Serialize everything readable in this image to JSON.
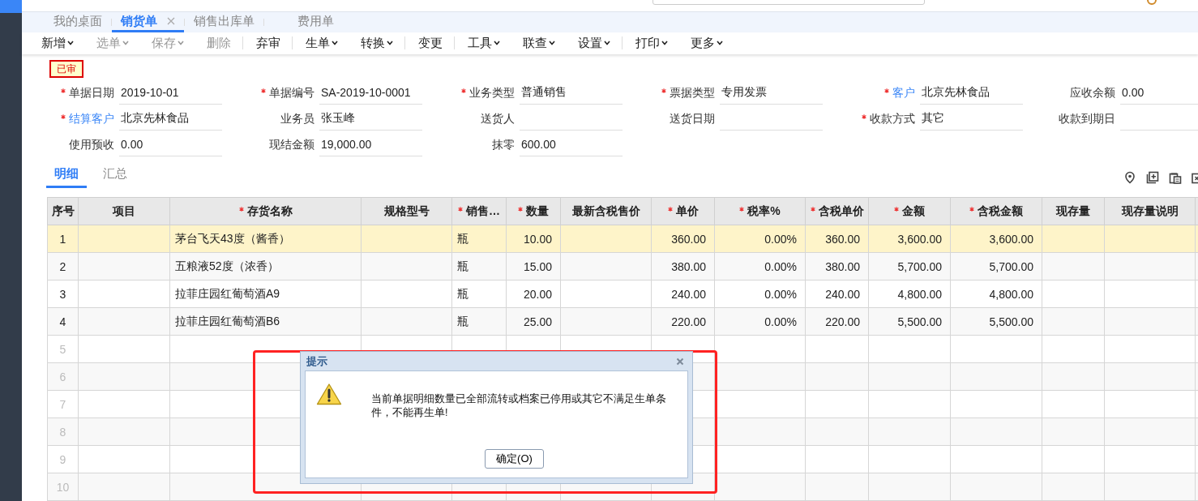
{
  "tabs": [
    {
      "label": "我的桌面",
      "selected": false,
      "closable": false
    },
    {
      "label": "销货单",
      "selected": true,
      "closable": true
    },
    {
      "label": "销售出库单",
      "selected": false,
      "closable": false
    },
    {
      "label": "费用单",
      "selected": false,
      "closable": false
    }
  ],
  "toolbar": [
    {
      "kind": "button",
      "label": "新增",
      "disabled": false,
      "dropdown": true
    },
    {
      "kind": "button",
      "label": "选单",
      "disabled": true,
      "dropdown": true
    },
    {
      "kind": "button",
      "label": "保存",
      "disabled": true,
      "dropdown": true
    },
    {
      "kind": "button",
      "label": "删除",
      "disabled": true,
      "dropdown": false
    },
    {
      "kind": "separator"
    },
    {
      "kind": "button",
      "label": "弃审",
      "disabled": false,
      "dropdown": false
    },
    {
      "kind": "separator"
    },
    {
      "kind": "button",
      "label": "生单",
      "disabled": false,
      "dropdown": true
    },
    {
      "kind": "button",
      "label": "转换",
      "disabled": false,
      "dropdown": true
    },
    {
      "kind": "separator"
    },
    {
      "kind": "button",
      "label": "变更",
      "disabled": false,
      "dropdown": false
    },
    {
      "kind": "separator"
    },
    {
      "kind": "button",
      "label": "工具",
      "disabled": false,
      "dropdown": true
    },
    {
      "kind": "button",
      "label": "联查",
      "disabled": false,
      "dropdown": true
    },
    {
      "kind": "button",
      "label": "设置",
      "disabled": false,
      "dropdown": true
    },
    {
      "kind": "separator"
    },
    {
      "kind": "button",
      "label": "打印",
      "disabled": false,
      "dropdown": true
    },
    {
      "kind": "button",
      "label": "更多",
      "disabled": false,
      "dropdown": true
    }
  ],
  "status_badge": "已审",
  "form_rows": [
    [
      {
        "label": "单据日期",
        "value": "2019-10-01",
        "required": true,
        "link": false
      },
      {
        "label": "单据编号",
        "value": "SA-2019-10-0001",
        "required": true,
        "link": false
      },
      {
        "label": "业务类型",
        "value": "普通销售",
        "required": true,
        "link": false
      },
      {
        "label": "票据类型",
        "value": "专用发票",
        "required": true,
        "link": false
      },
      {
        "label": "客户",
        "value": "北京先林食品",
        "required": true,
        "link": true
      },
      {
        "label": "应收余额",
        "value": "0.00",
        "required": false,
        "link": false
      }
    ],
    [
      {
        "label": "结算客户",
        "value": "北京先林食品",
        "required": true,
        "link": true
      },
      {
        "label": "业务员",
        "value": "张玉峰",
        "required": false,
        "link": false
      },
      {
        "label": "送货人",
        "required": false,
        "link": false
      },
      {
        "label": "送货日期",
        "required": false,
        "link": false
      },
      {
        "label": "收款方式",
        "value": "其它",
        "required": true,
        "link": false
      },
      {
        "label": "收款到期日",
        "required": false,
        "link": false
      }
    ],
    [
      {
        "label": "使用预收",
        "value": "0.00",
        "required": false,
        "link": false
      },
      {
        "label": "现结金额",
        "value": "19,000.00",
        "required": false,
        "link": false
      },
      {
        "label": "抹零",
        "value": "600.00",
        "required": false,
        "link": false
      }
    ]
  ],
  "detail_tabs": [
    {
      "label": "明细",
      "selected": true
    },
    {
      "label": "汇总",
      "selected": false
    }
  ],
  "table": {
    "columns": [
      {
        "label": "序号",
        "required": false
      },
      {
        "label": "项目",
        "required": false
      },
      {
        "label": "存货名称",
        "required": true
      },
      {
        "label": "规格型号",
        "required": false
      },
      {
        "label": "销售…",
        "required": true
      },
      {
        "label": "数量",
        "required": true
      },
      {
        "label": "最新含税售价",
        "required": false
      },
      {
        "label": "单价",
        "required": true
      },
      {
        "label": "税率%",
        "required": true
      },
      {
        "label": "含税单价",
        "required": true
      },
      {
        "label": "金额",
        "required": true
      },
      {
        "label": "含税金额",
        "required": true
      },
      {
        "label": "现存量",
        "required": false
      },
      {
        "label": "现存量说明",
        "required": false
      }
    ],
    "rows": [
      {
        "no": "1",
        "selected": true,
        "item": "茅台飞天43度（酱香）",
        "unit": "瓶",
        "qty": "10.00",
        "price": "360.00",
        "tax_rate": "0.00%",
        "tax_price": "360.00",
        "amount": "3,600.00",
        "tax_amount": "3,600.00"
      },
      {
        "no": "2",
        "selected": false,
        "item": "五粮液52度（浓香）",
        "unit": "瓶",
        "qty": "15.00",
        "price": "380.00",
        "tax_rate": "0.00%",
        "tax_price": "380.00",
        "amount": "5,700.00",
        "tax_amount": "5,700.00"
      },
      {
        "no": "3",
        "selected": false,
        "item": "拉菲庄园红葡萄酒A9",
        "unit": "瓶",
        "qty": "20.00",
        "price": "240.00",
        "tax_rate": "0.00%",
        "tax_price": "240.00",
        "amount": "4,800.00",
        "tax_amount": "4,800.00"
      },
      {
        "no": "4",
        "selected": false,
        "item": "拉菲庄园红葡萄酒B6",
        "unit": "瓶",
        "qty": "25.00",
        "price": "220.00",
        "tax_rate": "0.00%",
        "tax_price": "220.00",
        "amount": "5,500.00",
        "tax_amount": "5,500.00"
      },
      {
        "no": "5",
        "selected": false
      },
      {
        "no": "6",
        "selected": false
      },
      {
        "no": "7",
        "selected": false
      },
      {
        "no": "8",
        "selected": false
      },
      {
        "no": "9",
        "selected": false
      },
      {
        "no": "10",
        "selected": false
      }
    ]
  },
  "dialog": {
    "title": "提示",
    "message": "当前单据明细数量已全部流转或档案已停用或其它不满足生单条件，不能再生单!",
    "button": "确定(O)"
  }
}
